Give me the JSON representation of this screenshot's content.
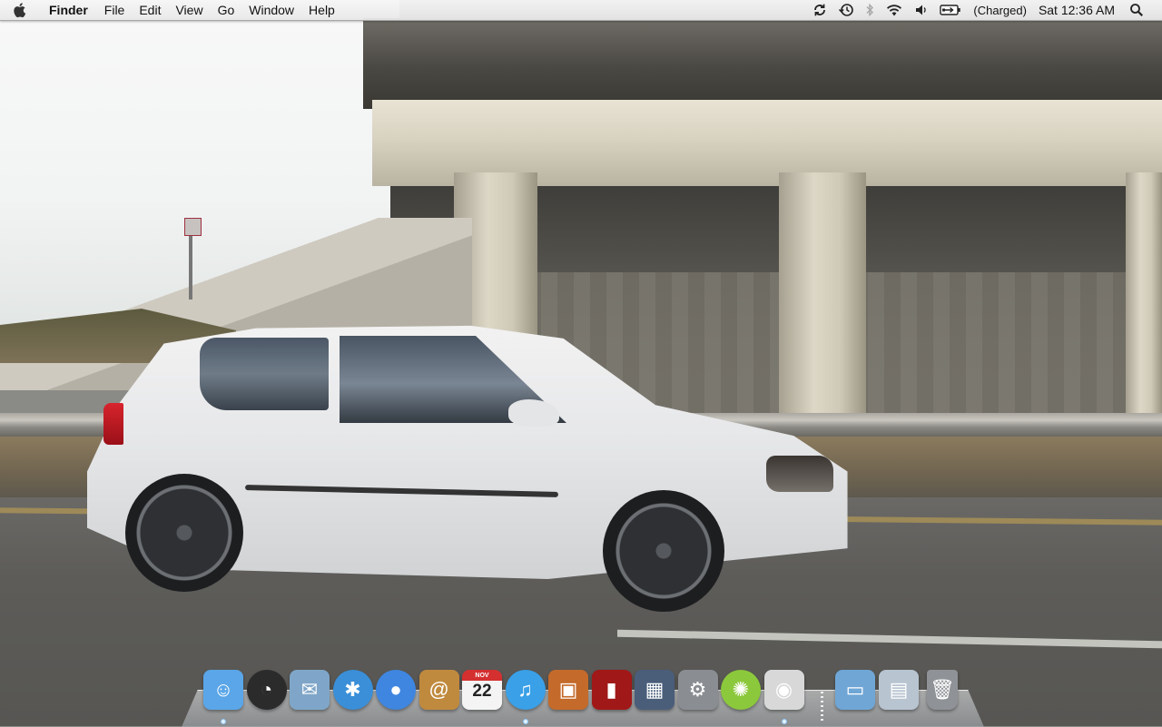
{
  "menubar": {
    "app_name": "Finder",
    "menus": [
      "File",
      "Edit",
      "View",
      "Go",
      "Window",
      "Help"
    ],
    "status_items": [
      "sync-icon",
      "time-machine-icon",
      "bluetooth-icon",
      "wifi-icon",
      "volume-icon",
      "battery-icon"
    ],
    "battery_text": "(Charged)",
    "clock": "Sat 12:36 AM"
  },
  "dock": {
    "apps": [
      {
        "name": "Finder",
        "icon": "finder-icon",
        "color": "#5aa6e8",
        "running": true
      },
      {
        "name": "Dashboard",
        "icon": "dashboard-icon",
        "color": "#2b2b2b",
        "running": false
      },
      {
        "name": "Mail",
        "icon": "mail-icon",
        "color": "#7fa6c8",
        "running": false
      },
      {
        "name": "Safari",
        "icon": "safari-icon",
        "color": "#3a8fd8",
        "running": false
      },
      {
        "name": "iChat",
        "icon": "ichat-icon",
        "color": "#3f86e0",
        "running": false
      },
      {
        "name": "Address Book",
        "icon": "address-book-icon",
        "color": "#c08a3e",
        "running": false
      },
      {
        "name": "iCal",
        "icon": "ical-icon",
        "color": "#eeeeee",
        "running": false,
        "month": "NOV",
        "day": "22"
      },
      {
        "name": "iTunes",
        "icon": "itunes-icon",
        "color": "#3aa0e8",
        "running": true
      },
      {
        "name": "iPhoto",
        "icon": "iphoto-icon",
        "color": "#c46a2a",
        "running": false
      },
      {
        "name": "Front Row",
        "icon": "front-row-icon",
        "color": "#a01818",
        "running": false
      },
      {
        "name": "Spaces",
        "icon": "spaces-icon",
        "color": "#4a5e7a",
        "running": false
      },
      {
        "name": "System Preferences",
        "icon": "system-preferences-icon",
        "color": "#8a8d92",
        "running": false
      },
      {
        "name": "LimeWire",
        "icon": "limewire-icon",
        "color": "#8cc83c",
        "running": false
      },
      {
        "name": "Preview",
        "icon": "preview-icon",
        "color": "#d8d8d8",
        "running": true
      }
    ],
    "stacks": [
      {
        "name": "Documents",
        "icon": "folder-icon",
        "color": "#6fa6d6"
      },
      {
        "name": "Downloads",
        "icon": "downloads-stack-icon",
        "color": "#b8c4d0"
      },
      {
        "name": "Trash",
        "icon": "trash-icon",
        "color": "#8f9296"
      }
    ]
  }
}
